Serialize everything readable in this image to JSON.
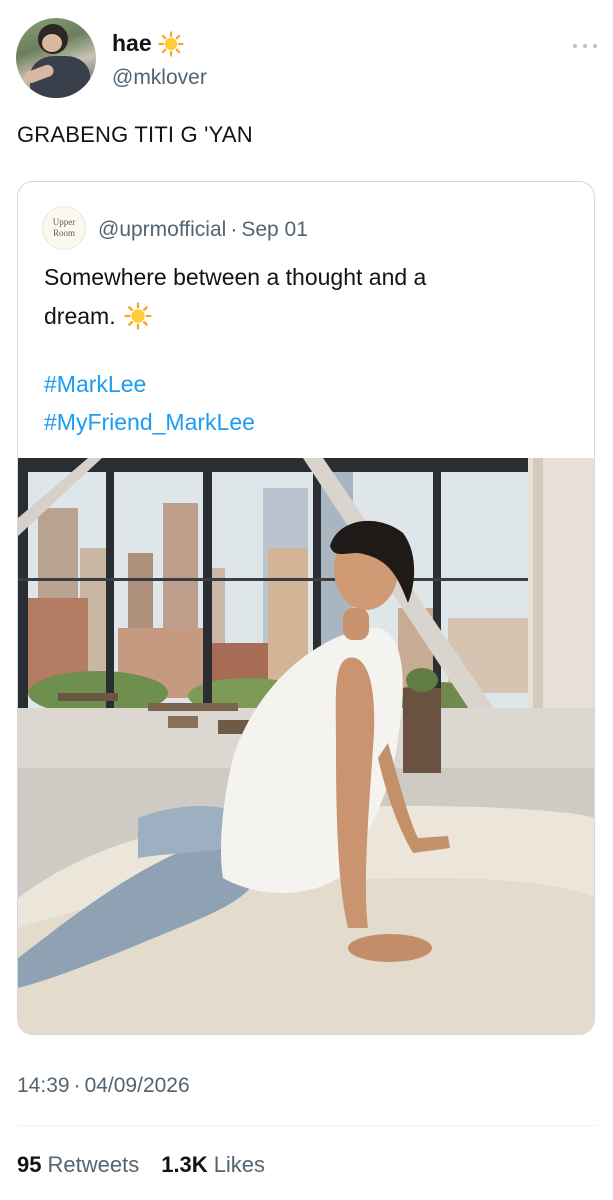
{
  "author": {
    "display_name": "hae",
    "name_emoji": "sun-emoji",
    "handle": "@mklover"
  },
  "tweet": {
    "text": "GRABENG TITI G 'YAN"
  },
  "quoted": {
    "avatar_text_line1": "Upper",
    "avatar_text_line2": "Room",
    "handle": "@uprmofficial",
    "separator": "·",
    "date": "Sep 01",
    "text_line1": "Somewhere between a thought and a",
    "text_line2": "dream.",
    "hashtags": [
      "#MarkLee",
      "#MyFriend_MarkLee"
    ]
  },
  "footer": {
    "time": "14:39",
    "separator": "·",
    "date": "04/09/2026"
  },
  "stats": {
    "retweets_count": "95",
    "retweets_label": "Retweets",
    "likes_count": "1.3K",
    "likes_label": "Likes"
  },
  "colors": {
    "link": "#1d9bf0",
    "secondary_text": "#536471",
    "primary_text": "#0f1419",
    "border": "#cfd9de"
  }
}
